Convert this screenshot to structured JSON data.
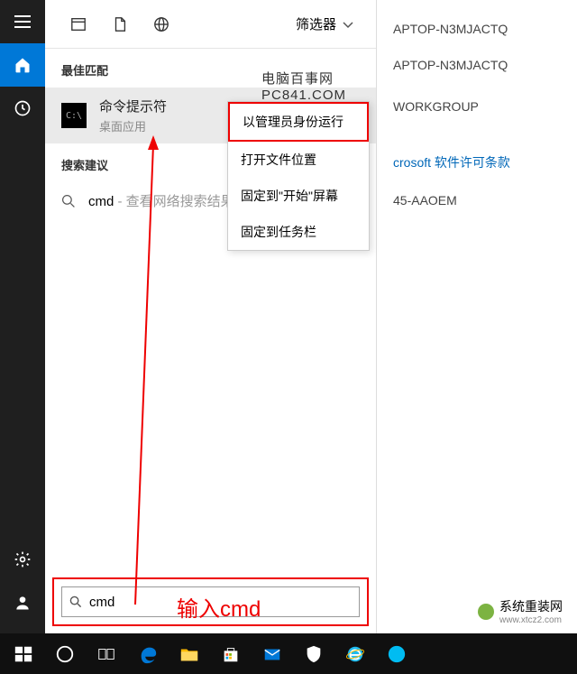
{
  "sidebar": {
    "items": [
      "menu",
      "home",
      "clock",
      "settings",
      "user"
    ]
  },
  "header": {
    "filter_label": "筛选器"
  },
  "watermark": "电脑百事网 PC841.COM",
  "sections": {
    "best_match": "最佳匹配",
    "suggestions": "搜索建议"
  },
  "result": {
    "title": "命令提示符",
    "subtitle": "桌面应用",
    "icon_text": "C:\\"
  },
  "suggestion": {
    "term": "cmd",
    "extra": " - 查看网络搜索结果"
  },
  "context_menu": {
    "items": [
      "以管理员身份运行",
      "打开文件位置",
      "固定到\"开始\"屏幕",
      "固定到任务栏"
    ]
  },
  "search": {
    "value": "cmd"
  },
  "annotations": {
    "input_label": "输入cmd"
  },
  "background": {
    "device1": "APTOP-N3MJACTQ",
    "device2": "APTOP-N3MJACTQ",
    "workgroup": "WORKGROUP",
    "license_link": "crosoft 软件许可条款",
    "product_id": "45-AAOEM"
  },
  "site_watermark": {
    "name": "系统重装网",
    "url": "www.xtcz2.com"
  }
}
